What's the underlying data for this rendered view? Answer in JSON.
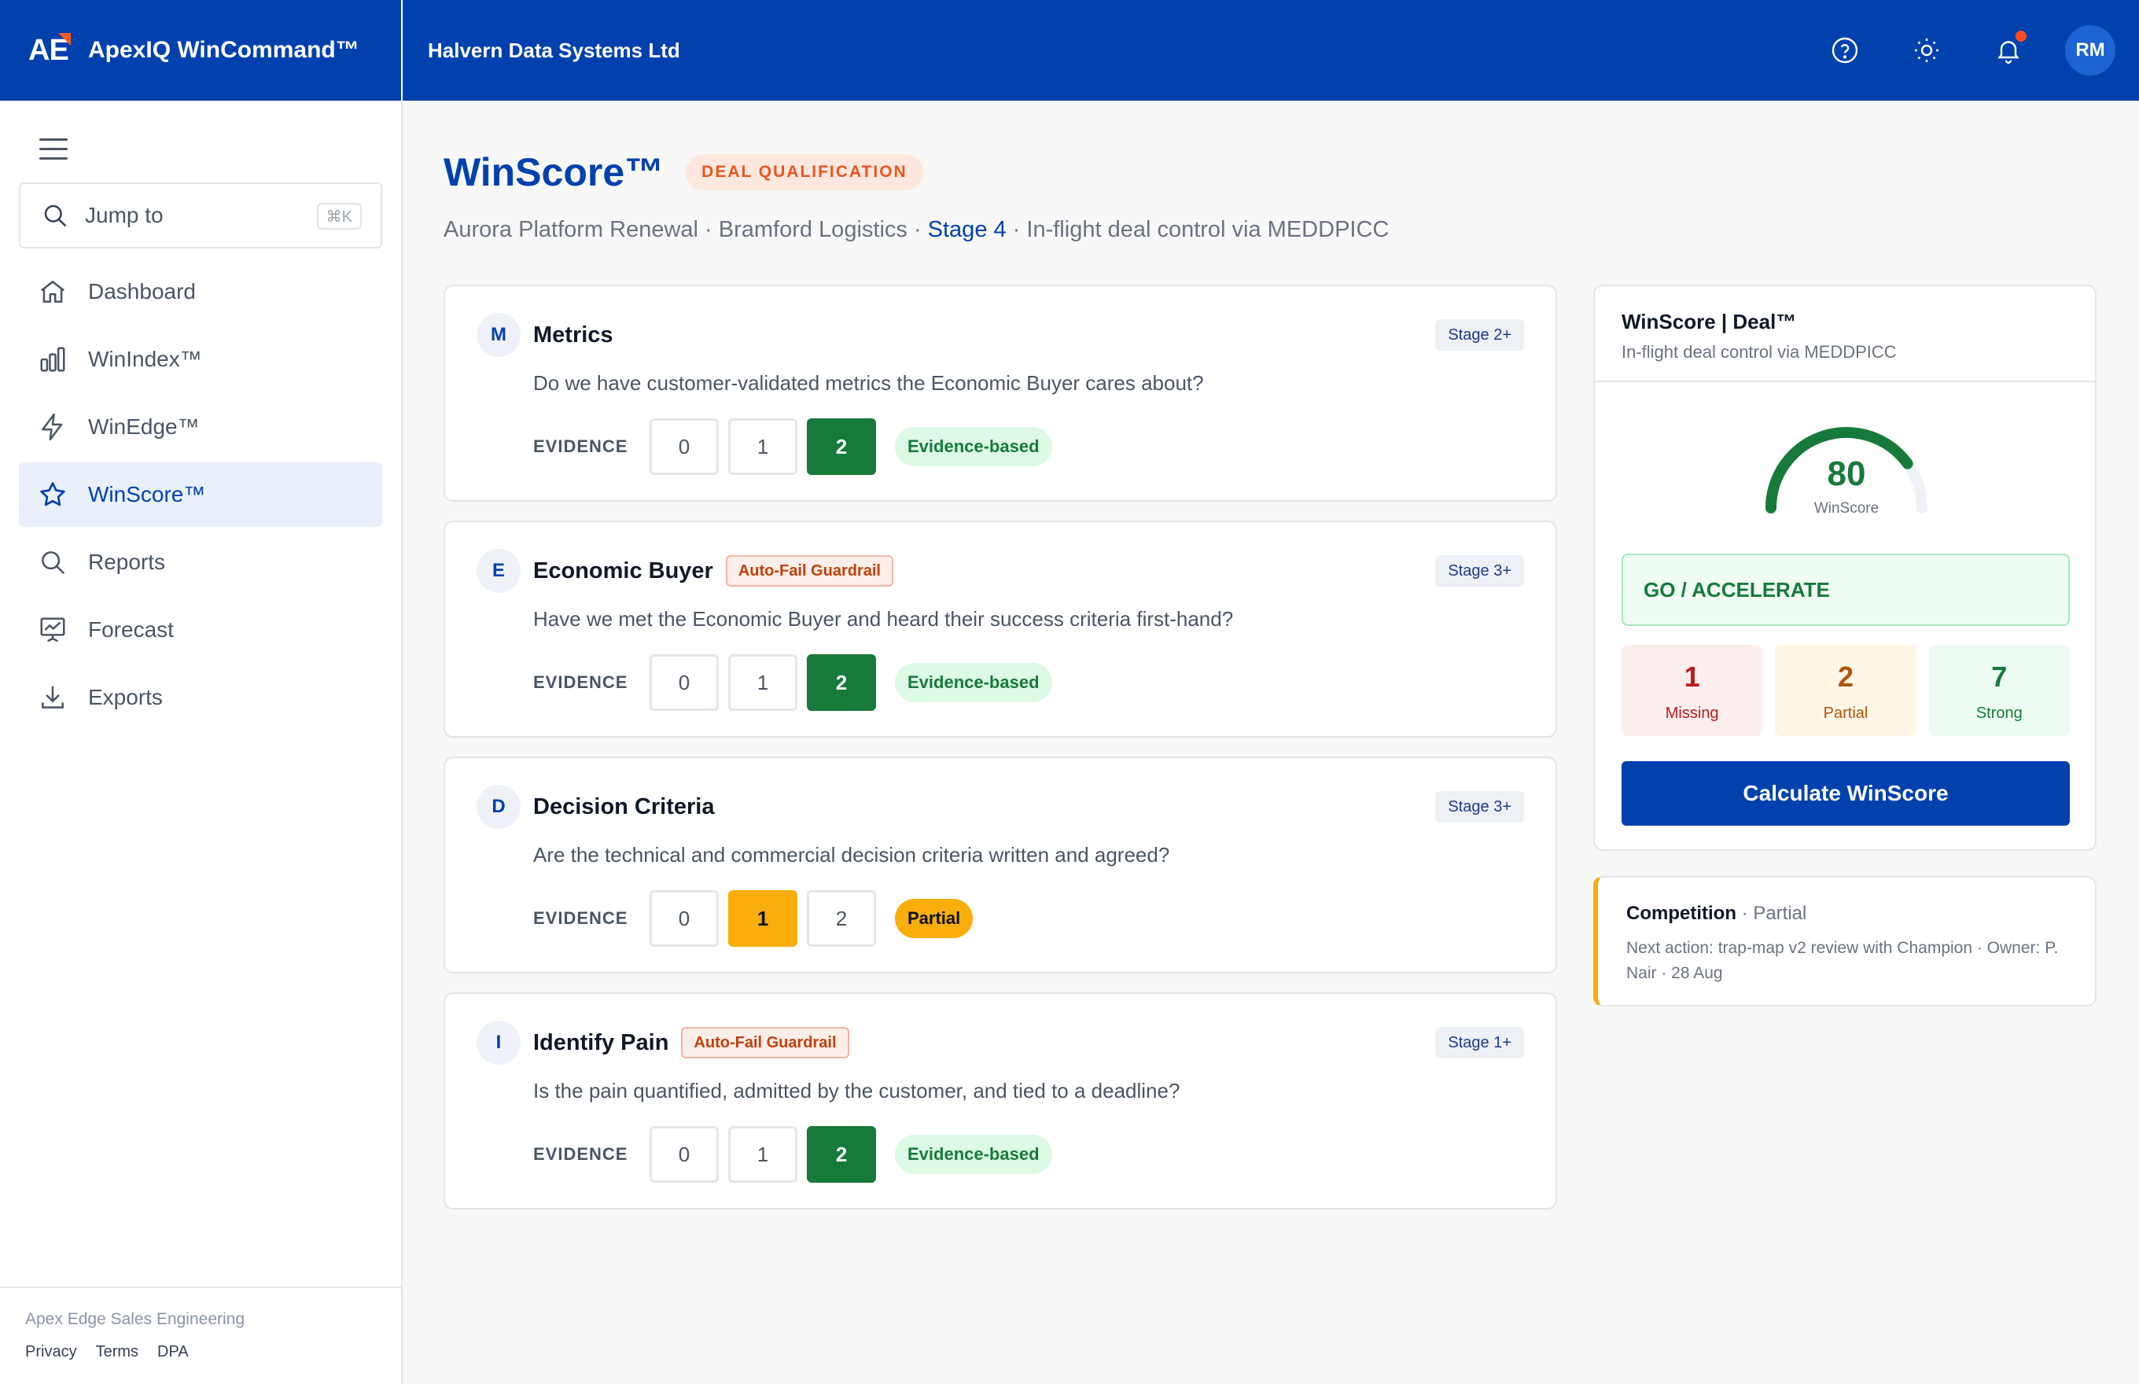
{
  "header": {
    "logo_text": "AE",
    "app_name": "ApexIQ WinCommand™",
    "org_name": "Halvern Data Systems Ltd",
    "avatar_initials": "RM",
    "accent_color": "#0041ad",
    "notification_dot_color": "#ff4d1f"
  },
  "sidebar": {
    "jump_label": "Jump to",
    "jump_shortcut": "⌘K",
    "items": [
      {
        "label": "Dashboard",
        "icon": "home-icon"
      },
      {
        "label": "WinIndex™",
        "icon": "bar-chart-icon"
      },
      {
        "label": "WinEdge™",
        "icon": "bolt-icon"
      },
      {
        "label": "WinScore™",
        "icon": "star-icon",
        "active": true
      },
      {
        "label": "Reports",
        "icon": "search-icon"
      },
      {
        "label": "Forecast",
        "icon": "presentation-chart-icon"
      },
      {
        "label": "Exports",
        "icon": "download-icon"
      }
    ],
    "footer": {
      "org": "Apex Edge Sales Engineering",
      "links": [
        "Privacy",
        "Terms",
        "DPA"
      ]
    }
  },
  "page": {
    "title": "WinScore™",
    "badge": "DEAL QUALIFICATION",
    "subtitle_pre": "Aurora Platform Renewal · Bramford Logistics · ",
    "subtitle_stage": "Stage 4",
    "subtitle_post": " · In-flight deal control via MEDDPICC"
  },
  "criteria": [
    {
      "letter": "M",
      "name": "Metrics",
      "guardrail": "",
      "stage": "Stage 2+",
      "question": "Do we have customer-validated metrics the Economic Buyer cares about?",
      "evidence_label": "EVIDENCE",
      "options": [
        "0",
        "1",
        "2"
      ],
      "selected": 2,
      "status": "Evidence-based"
    },
    {
      "letter": "E",
      "name": "Economic Buyer",
      "guardrail": "Auto-Fail Guardrail",
      "stage": "Stage 3+",
      "question": "Have we met the Economic Buyer and heard their success criteria first-hand?",
      "evidence_label": "EVIDENCE",
      "options": [
        "0",
        "1",
        "2"
      ],
      "selected": 2,
      "status": "Evidence-based"
    },
    {
      "letter": "D",
      "name": "Decision Criteria",
      "guardrail": "",
      "stage": "Stage 3+",
      "question": "Are the technical and commercial decision criteria written and agreed?",
      "evidence_label": "EVIDENCE",
      "options": [
        "0",
        "1",
        "2"
      ],
      "selected": 1,
      "status": "Partial"
    },
    {
      "letter": "I",
      "name": "Identify Pain",
      "guardrail": "Auto-Fail Guardrail",
      "stage": "Stage 1+",
      "question": "Is the pain quantified, admitted by the customer, and tied to a deadline?",
      "evidence_label": "EVIDENCE",
      "options": [
        "0",
        "1",
        "2"
      ],
      "selected": 2,
      "status": "Evidence-based"
    }
  ],
  "score_panel": {
    "title": "WinScore | Deal™",
    "subtitle": "In-flight deal control via MEDDPICC",
    "score": "80",
    "score_value": 80,
    "score_max": 100,
    "score_label": "WinScore",
    "verdict": "GO / ACCELERATE",
    "counts": [
      {
        "value": "1",
        "label": "Missing"
      },
      {
        "value": "2",
        "label": "Partial"
      },
      {
        "value": "7",
        "label": "Strong"
      }
    ],
    "calculate_label": "Calculate WinScore",
    "gauge_color": "#177a3a"
  },
  "competition": {
    "title": "Competition",
    "state": "· Partial",
    "note": "Next action: trap-map v2 review with Champion · Owner: P. Nair · 28 Aug"
  }
}
